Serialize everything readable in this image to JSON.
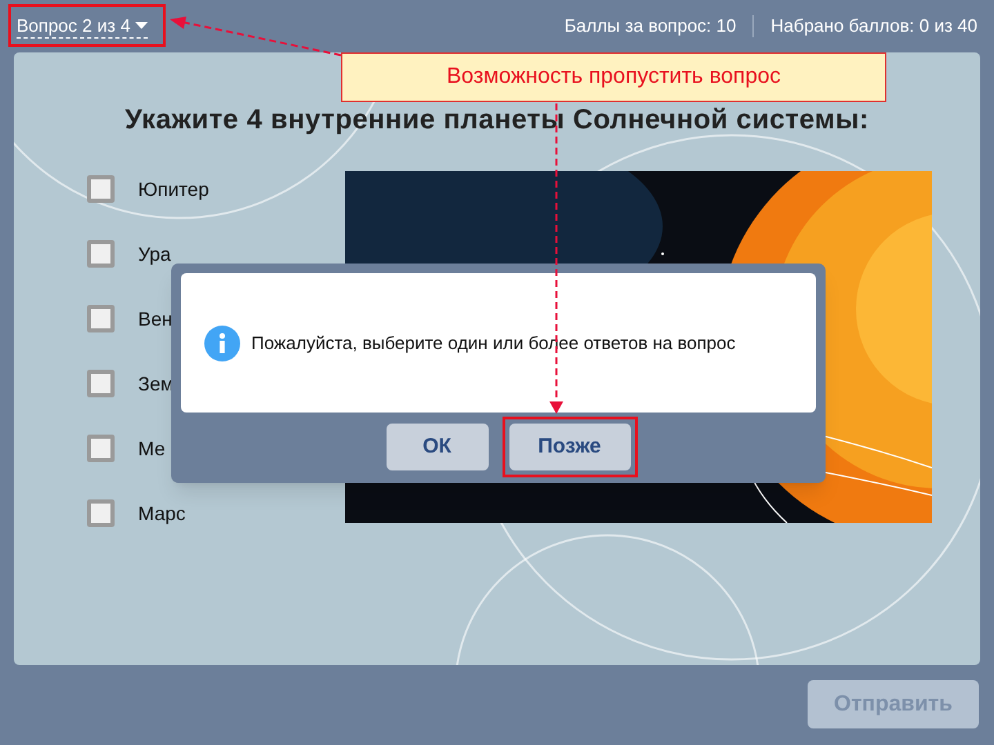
{
  "header": {
    "question_selector": {
      "label": "Вопрос 2 из 4"
    },
    "points_per_question": "Баллы за вопрос: 10",
    "points_total": "Набрано баллов: 0 из 40"
  },
  "question": {
    "title": "Укажите 4 внутренние планеты Солнечной системы:"
  },
  "answers": [
    {
      "label": "Юпитер",
      "checked": false
    },
    {
      "label": "Ура",
      "checked": false
    },
    {
      "label": "Вен",
      "checked": false
    },
    {
      "label": "Зем",
      "checked": false
    },
    {
      "label": "Ме",
      "checked": false
    },
    {
      "label": "Марс",
      "checked": false
    }
  ],
  "dialog": {
    "message": "Пожалуйста, выберите один или более ответов на вопрос",
    "buttons": [
      {
        "label": "ОК",
        "highlighted": false
      },
      {
        "label": "Позже",
        "highlighted": true
      }
    ]
  },
  "submit": {
    "label": "Отправить",
    "disabled": true
  },
  "annotation": {
    "callout": "Возможность пропустить вопрос",
    "highlight_selector": true
  }
}
